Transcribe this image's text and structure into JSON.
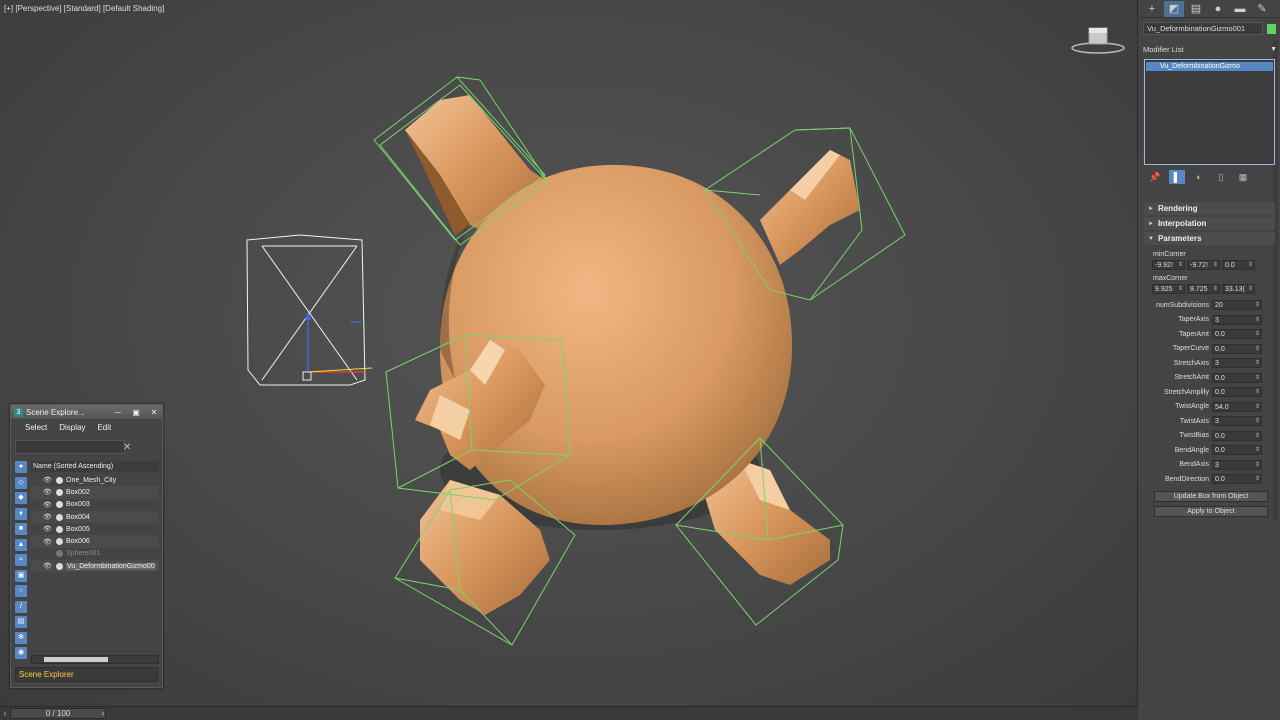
{
  "viewport": {
    "label": "[+] [Perspective] [Standard] [Default Shading]"
  },
  "timeline": {
    "frame_display": "0 / 100",
    "prev_icon": "prev-frame-icon",
    "next_icon": "next-frame-icon"
  },
  "command_panel": {
    "tabs": [
      "create-icon",
      "modify-icon",
      "hierarchy-icon",
      "motion-icon",
      "display-icon",
      "utilities-icon"
    ],
    "object_name": "Vu_DeformbinationGizmo001",
    "object_color": "#5fd463",
    "modifier_list_label": "Modifier List",
    "modifier_stack": [
      "Vu_DeformbinationGizmo"
    ],
    "rollouts": {
      "rendering": "Rendering",
      "interpolation": "Interpolation",
      "parameters": "Parameters"
    },
    "params": {
      "min_corner_label": "minCorner",
      "min_corner": [
        "-9.92!",
        "-9.72!",
        "0.0"
      ],
      "max_corner_label": "maxCorner",
      "max_corner": [
        "9.925",
        "9.725",
        "33.13("
      ],
      "rows": [
        {
          "label": "numSubdivisions",
          "value": "20"
        },
        {
          "label": "TaperAxis",
          "value": "3"
        },
        {
          "label": "TaperAmt",
          "value": "0.0"
        },
        {
          "label": "TaperCurve",
          "value": "0.0"
        },
        {
          "label": "StretchAxis",
          "value": "3"
        },
        {
          "label": "StretchAmt",
          "value": "0.0"
        },
        {
          "label": "StretchAmplify",
          "value": "0.0"
        },
        {
          "label": "TwistAngle",
          "value": "54.0"
        },
        {
          "label": "TwistAxis",
          "value": "3"
        },
        {
          "label": "TwistBias",
          "value": "0.0"
        },
        {
          "label": "BendAngle",
          "value": "0.0"
        },
        {
          "label": "BendAxis",
          "value": "3"
        },
        {
          "label": "BendDirection",
          "value": "0.0"
        }
      ],
      "update_button": "Update Box from Object",
      "apply_button": "Apply to Object"
    }
  },
  "scene_explorer": {
    "title": "Scene Explore...",
    "menu": [
      "Select",
      "Display",
      "Edit"
    ],
    "column_header": "Name (Sorted Ascending)",
    "items": [
      {
        "name": "One_Mesh_City",
        "hidden": false
      },
      {
        "name": "Box002",
        "hidden": false
      },
      {
        "name": "Box003",
        "hidden": false
      },
      {
        "name": "Box004",
        "hidden": false
      },
      {
        "name": "Box005",
        "hidden": false
      },
      {
        "name": "Box006",
        "hidden": false
      },
      {
        "name": "Sphere001",
        "hidden": true
      },
      {
        "name": "Vu_DeformbinationGizmo00",
        "hidden": false,
        "selected": true
      }
    ],
    "footer": "Scene Explorer"
  }
}
